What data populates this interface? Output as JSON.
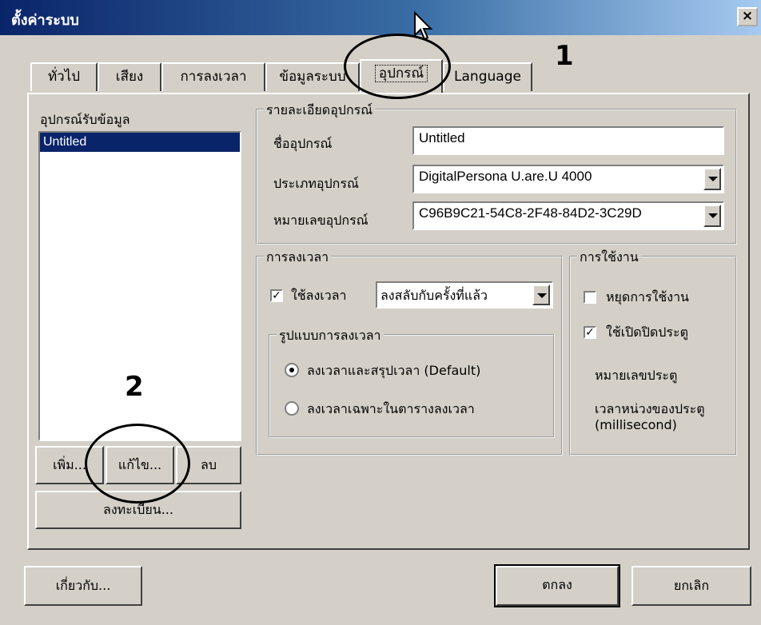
{
  "window": {
    "title": "ตั้งค่าระบบ",
    "close_label": "×"
  },
  "tabs": [
    {
      "label": "ทั่วไป"
    },
    {
      "label": "เสียง"
    },
    {
      "label": "การลงเวลา"
    },
    {
      "label": "ข้อมูลระบบ"
    },
    {
      "label": "อุปกรณ์",
      "active": true
    },
    {
      "label": "Language"
    }
  ],
  "devices": {
    "label": "อุปกรณ์รับข้อมูล",
    "items": [
      "Untitled"
    ],
    "selected": "Untitled",
    "add_label": "เพิ่ม...",
    "edit_label": "แก้ไข...",
    "delete_label": "ลบ",
    "register_label": "ลงทะเบียน..."
  },
  "details": {
    "title": "รายละเอียดอุปกรณ์",
    "name_label": "ชื่ออุปกรณ์",
    "name_value": "Untitled",
    "type_label": "ประเภทอุปกรณ์",
    "type_value": "DigitalPersona U.are.U 4000",
    "serial_label": "หมายเลขอุปกรณ์",
    "serial_value": "C96B9C21-54C8-2F48-84D2-3C29D"
  },
  "timekeeping": {
    "title": "การลงเวลา",
    "use_label": "ใช้ลงเวลา",
    "use_checked": true,
    "mode_value": "ลงสลับกับครั้งที่แล้ว",
    "format_title": "รูปแบบการลงเวลา",
    "option_default": "ลงเวลาและสรุปเวลา (Default)",
    "option_table": "ลงเวลาเฉพาะในตารางลงเวลา",
    "selected_option": "default"
  },
  "usage": {
    "title": "การใช้งาน",
    "stop_label": "หยุดการใช้งาน",
    "stop_checked": false,
    "door_label": "ใช้เปิดปิดประตู",
    "door_checked": true,
    "door_number_label": "หมายเลขประตู",
    "delay_label": "เวลาหน่วงของประตู",
    "delay_unit": "(millisecond)"
  },
  "footer": {
    "about_label": "เกี่ยวกับ...",
    "ok_label": "ตกลง",
    "cancel_label": "ยกเลิก"
  },
  "annotations": {
    "step1": "1",
    "step2": "2"
  }
}
